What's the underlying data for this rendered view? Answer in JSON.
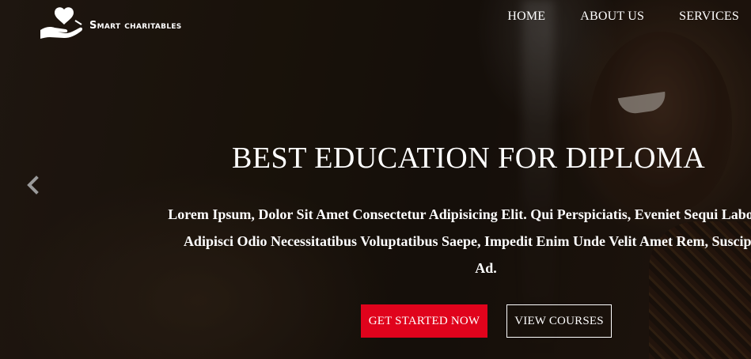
{
  "brand": {
    "name": "Smart charitables",
    "logo_icon": "heart-in-hand-icon"
  },
  "nav": {
    "items": [
      "HOME",
      "ABOUT US",
      "SERVICES"
    ]
  },
  "slider": {
    "prev_icon": "chevron-left-icon"
  },
  "hero": {
    "title": "BEST EDUCATION FOR DIPLOMA",
    "line1": "Lorem Ipsum, Dolor Sit Amet Consectetur Adipisicing Elit. Qui Perspiciatis, Eveniet Sequi Laborum Ab,",
    "line2": "Adipisci Odio Necessitatibus Voluptatibus Saepe, Impedit Enim Unde Velit Amet Rem, Suscipit Sint",
    "line3": "Ad.",
    "primary_button": "GET STARTED NOW",
    "secondary_button": "VIEW COURSES"
  },
  "colors": {
    "accent": "#e0031c",
    "text": "#ffffff"
  }
}
